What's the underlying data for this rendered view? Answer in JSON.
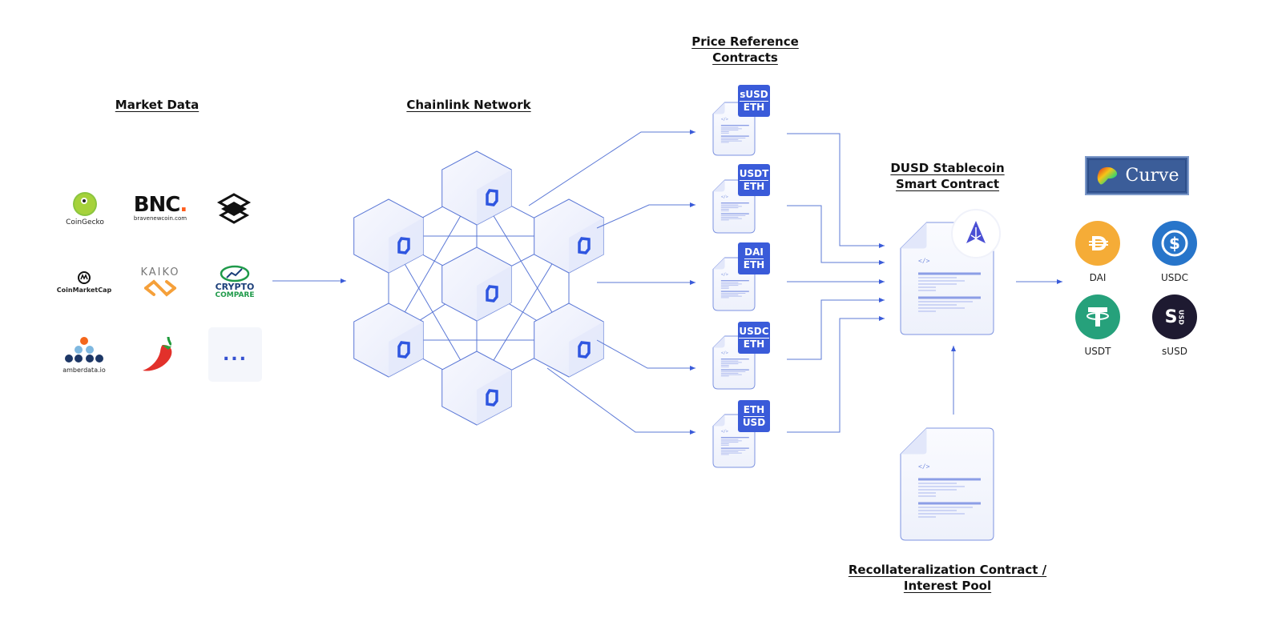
{
  "headings": {
    "market_data": "Market Data",
    "chainlink_network": "Chainlink Network",
    "price_reference_1": "Price Reference",
    "price_reference_2": "Contracts",
    "dusd_1": "DUSD Stablecoin",
    "dusd_2": "Smart Contract",
    "recollat_1": "Recollateralization Contract /",
    "recollat_2": "Interest Pool"
  },
  "market_data_sources": [
    {
      "name": "CoinGecko",
      "caption": "CoinGecko"
    },
    {
      "name": "BraveNewCoin",
      "logo_text": "BNC",
      "logo_dot": ".",
      "caption": "bravenewcoin.com"
    },
    {
      "name": "Layers",
      "caption": ""
    },
    {
      "name": "CoinMarketCap",
      "caption": "CoinMarketCap"
    },
    {
      "name": "Kaiko",
      "caption": "KAIKO"
    },
    {
      "name": "CryptoCompare",
      "caption_1": "CRYPTO",
      "caption_2": "COMPARE"
    },
    {
      "name": "Amberdata",
      "caption": "amberdata.io"
    },
    {
      "name": "Chili",
      "caption": ""
    },
    {
      "name": "More",
      "caption": "..."
    }
  ],
  "price_contracts": [
    {
      "top": "sUSD",
      "bottom": "ETH"
    },
    {
      "top": "USDT",
      "bottom": "ETH"
    },
    {
      "top": "DAI",
      "bottom": "ETH"
    },
    {
      "top": "USDC",
      "bottom": "ETH"
    },
    {
      "top": "ETH",
      "bottom": "USD"
    }
  ],
  "curve": {
    "label": "Curve"
  },
  "stablecoins": [
    {
      "label": "DAI",
      "color": "#f5ac37"
    },
    {
      "label": "USDC",
      "color": "#2775ca"
    },
    {
      "label": "USDT",
      "color": "#26a17b"
    },
    {
      "label": "sUSD",
      "color": "#1e1a31"
    }
  ],
  "colors": {
    "accent": "#3a5bd9",
    "line": "#5b78d6",
    "node_fill": "#eef1fc"
  }
}
